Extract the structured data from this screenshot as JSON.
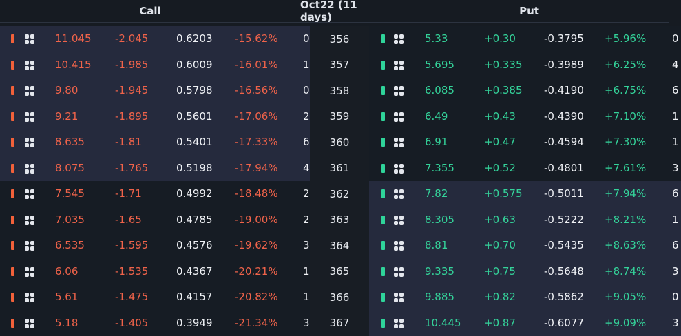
{
  "header": {
    "call_label": "Call",
    "expiry_label": "Oct22 (11 days)",
    "put_label": "Put"
  },
  "colors": {
    "call_accent": "#f2613a",
    "put_accent": "#2fd49a",
    "itm_bg": "#252a3d",
    "otm_bg": "#161c24"
  },
  "rows": [
    {
      "call": {
        "price": "11.045",
        "change": "-2.045",
        "delta": "0.6203",
        "pct": "-15.62%",
        "trunc": "0"
      },
      "strike": "356",
      "put": {
        "price": "5.33",
        "change": "+0.30",
        "delta": "-0.3795",
        "pct": "+5.96%",
        "trunc": "0"
      },
      "call_itm": true,
      "put_itm": false
    },
    {
      "call": {
        "price": "10.415",
        "change": "-1.985",
        "delta": "0.6009",
        "pct": "-16.01%",
        "trunc": "1"
      },
      "strike": "357",
      "put": {
        "price": "5.695",
        "change": "+0.335",
        "delta": "-0.3989",
        "pct": "+6.25%",
        "trunc": "4"
      },
      "call_itm": true,
      "put_itm": false
    },
    {
      "call": {
        "price": "9.80",
        "change": "-1.945",
        "delta": "0.5798",
        "pct": "-16.56%",
        "trunc": "0"
      },
      "strike": "358",
      "put": {
        "price": "6.085",
        "change": "+0.385",
        "delta": "-0.4190",
        "pct": "+6.75%",
        "trunc": "6"
      },
      "call_itm": true,
      "put_itm": false
    },
    {
      "call": {
        "price": "9.21",
        "change": "-1.895",
        "delta": "0.5601",
        "pct": "-17.06%",
        "trunc": "2"
      },
      "strike": "359",
      "put": {
        "price": "6.49",
        "change": "+0.43",
        "delta": "-0.4390",
        "pct": "+7.10%",
        "trunc": "1"
      },
      "call_itm": true,
      "put_itm": false
    },
    {
      "call": {
        "price": "8.635",
        "change": "-1.81",
        "delta": "0.5401",
        "pct": "-17.33%",
        "trunc": "6"
      },
      "strike": "360",
      "put": {
        "price": "6.91",
        "change": "+0.47",
        "delta": "-0.4594",
        "pct": "+7.30%",
        "trunc": "1"
      },
      "call_itm": true,
      "put_itm": false
    },
    {
      "call": {
        "price": "8.075",
        "change": "-1.765",
        "delta": "0.5198",
        "pct": "-17.94%",
        "trunc": "4"
      },
      "strike": "361",
      "put": {
        "price": "7.355",
        "change": "+0.52",
        "delta": "-0.4801",
        "pct": "+7.61%",
        "trunc": "3"
      },
      "call_itm": true,
      "put_itm": false
    },
    {
      "call": {
        "price": "7.545",
        "change": "-1.71",
        "delta": "0.4992",
        "pct": "-18.48%",
        "trunc": "2"
      },
      "strike": "362",
      "put": {
        "price": "7.82",
        "change": "+0.575",
        "delta": "-0.5011",
        "pct": "+7.94%",
        "trunc": "6"
      },
      "call_itm": false,
      "put_itm": true
    },
    {
      "call": {
        "price": "7.035",
        "change": "-1.65",
        "delta": "0.4785",
        "pct": "-19.00%",
        "trunc": "2"
      },
      "strike": "363",
      "put": {
        "price": "8.305",
        "change": "+0.63",
        "delta": "-0.5222",
        "pct": "+8.21%",
        "trunc": "1"
      },
      "call_itm": false,
      "put_itm": true
    },
    {
      "call": {
        "price": "6.535",
        "change": "-1.595",
        "delta": "0.4576",
        "pct": "-19.62%",
        "trunc": "3"
      },
      "strike": "364",
      "put": {
        "price": "8.81",
        "change": "+0.70",
        "delta": "-0.5435",
        "pct": "+8.63%",
        "trunc": "6"
      },
      "call_itm": false,
      "put_itm": true
    },
    {
      "call": {
        "price": "6.06",
        "change": "-1.535",
        "delta": "0.4367",
        "pct": "-20.21%",
        "trunc": "1"
      },
      "strike": "365",
      "put": {
        "price": "9.335",
        "change": "+0.75",
        "delta": "-0.5648",
        "pct": "+8.74%",
        "trunc": "3"
      },
      "call_itm": false,
      "put_itm": true
    },
    {
      "call": {
        "price": "5.61",
        "change": "-1.475",
        "delta": "0.4157",
        "pct": "-20.82%",
        "trunc": "1"
      },
      "strike": "366",
      "put": {
        "price": "9.885",
        "change": "+0.82",
        "delta": "-0.5862",
        "pct": "+9.05%",
        "trunc": "0"
      },
      "call_itm": false,
      "put_itm": true
    },
    {
      "call": {
        "price": "5.18",
        "change": "-1.405",
        "delta": "0.3949",
        "pct": "-21.34%",
        "trunc": "3"
      },
      "strike": "367",
      "put": {
        "price": "10.445",
        "change": "+0.87",
        "delta": "-0.6077",
        "pct": "+9.09%",
        "trunc": "3"
      },
      "call_itm": false,
      "put_itm": true
    }
  ]
}
